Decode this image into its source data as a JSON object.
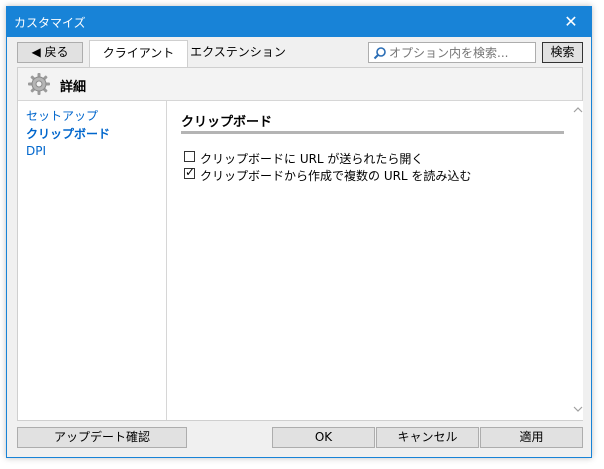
{
  "window": {
    "title": "カスタマイズ",
    "close_glyph": "✕"
  },
  "toolbar": {
    "back_label": "◀  戻る",
    "tabs": [
      {
        "label": "クライアント",
        "active": true
      },
      {
        "label": "エクステンション",
        "active": false
      }
    ],
    "search": {
      "placeholder": "オプション内を検索...",
      "value": ""
    },
    "search_button_label": "検索"
  },
  "section": {
    "title": "詳細",
    "icon": "gear-icon"
  },
  "sidebar": {
    "items": [
      {
        "label": "セットアップ",
        "active": false
      },
      {
        "label": "クリップボード",
        "active": true
      },
      {
        "label": "DPI",
        "active": false
      }
    ]
  },
  "panel": {
    "title": "クリップボード",
    "options": [
      {
        "label": "クリップボードに URL が送られたら開く",
        "checked": false
      },
      {
        "label": "クリップボードから作成で複数の URL を読み込む",
        "checked": true
      }
    ],
    "check_glyph": "✓"
  },
  "footer": {
    "update_label": "アップデート確認",
    "ok_label": "OK",
    "cancel_label": "キャンセル",
    "apply_label": "適用"
  },
  "colors": {
    "title_bar": "#1883d7",
    "link": "#0066cc"
  }
}
